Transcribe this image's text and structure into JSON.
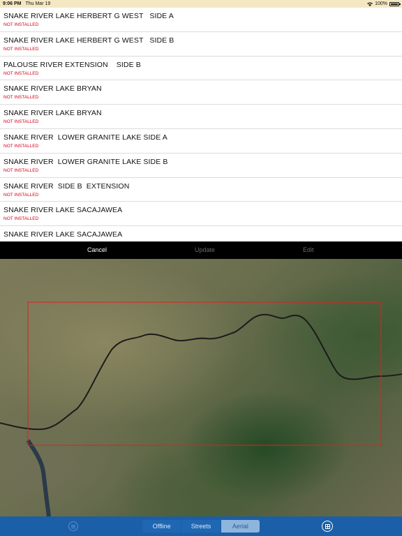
{
  "status_bar": {
    "time": "9:06 PM",
    "date": "Thu Mar 19",
    "battery": "100%"
  },
  "lakes": [
    {
      "title": "SNAKE RIVER LAKE HERBERT G WEST   SIDE A",
      "status": "NOT INSTALLED"
    },
    {
      "title": "SNAKE RIVER LAKE HERBERT G WEST   SIDE B",
      "status": "NOT INSTALLED"
    },
    {
      "title": "PALOUSE RIVER EXTENSION    SIDE B",
      "status": "NOT INSTALLED"
    },
    {
      "title": "SNAKE RIVER LAKE BRYAN",
      "status": "NOT INSTALLED"
    },
    {
      "title": "SNAKE RIVER LAKE BRYAN",
      "status": "NOT INSTALLED"
    },
    {
      "title": "SNAKE RIVER  LOWER GRANITE LAKE SIDE A",
      "status": "NOT INSTALLED"
    },
    {
      "title": "SNAKE RIVER  LOWER GRANITE LAKE SIDE B",
      "status": "NOT INSTALLED"
    },
    {
      "title": "SNAKE RIVER  SIDE B  EXTENSION",
      "status": "NOT INSTALLED"
    },
    {
      "title": "SNAKE RIVER LAKE SACAJAWEA",
      "status": "NOT INSTALLED"
    },
    {
      "title": "SNAKE RIVER LAKE SACAJAWEA",
      "status": ""
    }
  ],
  "action_bar": {
    "cancel": "Cancel",
    "update": "Update",
    "edit": "Edit"
  },
  "map": {
    "selection_color": "#e02020",
    "river_color": "#1b1b1b"
  },
  "bottom_bar": {
    "menu_icon": "list-icon",
    "segments": [
      "Offline",
      "Streets",
      "Aerial"
    ],
    "selected_segment": "Aerial",
    "layers_icon": "grid-icon"
  }
}
